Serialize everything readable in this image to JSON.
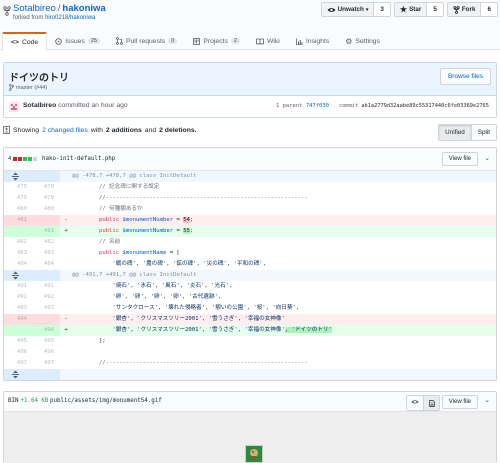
{
  "repo": {
    "owner": "Sotalbireo",
    "separator": "/",
    "name": "hakoniwa",
    "forked_prefix": "forked from ",
    "forked_from": "hiro0218/hakoniwa"
  },
  "actions": {
    "watch": {
      "label": "Unwatch",
      "count": "3"
    },
    "star": {
      "label": "Star",
      "count": "5"
    },
    "fork": {
      "label": "Fork",
      "count": "6"
    }
  },
  "tabs": [
    {
      "label": "Code",
      "icon": "code-icon",
      "count": ""
    },
    {
      "label": "Issues",
      "icon": "issue-icon",
      "count": "25"
    },
    {
      "label": "Pull requests",
      "icon": "pull-request-icon",
      "count": "0"
    },
    {
      "label": "Projects",
      "icon": "project-icon",
      "count": "2"
    },
    {
      "label": "Wiki",
      "icon": "book-icon",
      "count": ""
    },
    {
      "label": "Insights",
      "icon": "graph-icon",
      "count": ""
    },
    {
      "label": "Settings",
      "icon": "gear-icon",
      "count": ""
    }
  ],
  "commit": {
    "title": "ドイツのトリ",
    "branch": "master (#44)",
    "browse_label": "Browse files",
    "author": "Sotalbireo",
    "time": "committed an hour ago",
    "parent_label": "1 parent",
    "parent_sha": "747f030",
    "commit_label": "commit",
    "commit_sha": "ab1a2779d32aabe89c55317440c6fe03369e2765"
  },
  "summary": {
    "prefix": "Showing",
    "changed": "2 changed files",
    "with": "with",
    "additions": "2 additions",
    "and": "and",
    "deletions": "2 deletions.",
    "unified": "Unified",
    "split": "Split"
  },
  "file1": {
    "changes": "4",
    "path": "hako-init-default.php",
    "view_label": "View file",
    "rows": [
      {
        "type": "hunk",
        "n1": "",
        "n2": "",
        "sign": "",
        "code": "@@ -478,7 +478,7 @@ class InitDefault"
      },
      {
        "type": "ctx",
        "n1": "475",
        "n2": "478",
        "sign": "",
        "code": "        // 記念碑に関する設定"
      },
      {
        "type": "ctx",
        "n1": "479",
        "n2": "479",
        "sign": "",
        "code": "        //------------------------------------------------------------"
      },
      {
        "type": "ctx",
        "n1": "480",
        "n2": "480",
        "sign": "",
        "code": "        // 何種類あるか"
      },
      {
        "type": "del",
        "n1": "481",
        "n2": "",
        "sign": "-",
        "code": "        public $monumentNumber = 54;"
      },
      {
        "type": "add",
        "n1": "",
        "n2": "481",
        "sign": "+",
        "code": "        public $monumentNumber = 55;"
      },
      {
        "type": "ctx",
        "n1": "482",
        "n2": "482",
        "sign": "",
        "code": "        // 名前"
      },
      {
        "type": "ctx",
        "n1": "483",
        "n2": "483",
        "sign": "",
        "code": "        public $monumentName = ["
      },
      {
        "type": "ctx",
        "n1": "484",
        "n2": "484",
        "sign": "",
        "code": "            '戦の碑', '農の碑', '鉱の碑', '災の碑', '平和の碑',"
      },
      {
        "type": "hunk",
        "n1": "",
        "n2": "",
        "sign": "",
        "code": "@@ -491,7 +491,7 @@ class InitDefault"
      },
      {
        "type": "ctx",
        "n1": "491",
        "n2": "491",
        "sign": "",
        "code": "            '焼石', '氷石', '風石', '炎石', '光石',"
      },
      {
        "type": "ctx",
        "n1": "492",
        "n2": "492",
        "sign": "",
        "code": "            '卵', '卵', '卵', '卵', '古代遺跡',"
      },
      {
        "type": "ctx",
        "n1": "493",
        "n2": "493",
        "sign": "",
        "code": "            'サンタクロース', '壊れた侵略者', '憩いの公園', '桜', '向日葵',"
      },
      {
        "type": "del",
        "n1": "494",
        "n2": "",
        "sign": "-",
        "code": "            '銀杏', 'クリスマスツリー2001', '雪うさぎ', '幸福の女神像'"
      },
      {
        "type": "add",
        "n1": "",
        "n2": "494",
        "sign": "+",
        "code": "            '銀杏', 'クリスマスツリー2001', '雪うさぎ', '幸福の女神像', 'ドイツのトリ'"
      },
      {
        "type": "ctx",
        "n1": "495",
        "n2": "495",
        "sign": "",
        "code": "        ];"
      },
      {
        "type": "ctx",
        "n1": "496",
        "n2": "496",
        "sign": "",
        "code": ""
      },
      {
        "type": "ctx",
        "n1": "497",
        "n2": "497",
        "sign": "",
        "code": "        //------------------------------------------------------------"
      }
    ]
  },
  "file2": {
    "changes": "BIN",
    "size": "+1.64 KB",
    "path": "public/assets/img/monument54.gif",
    "view_label": "View file"
  }
}
